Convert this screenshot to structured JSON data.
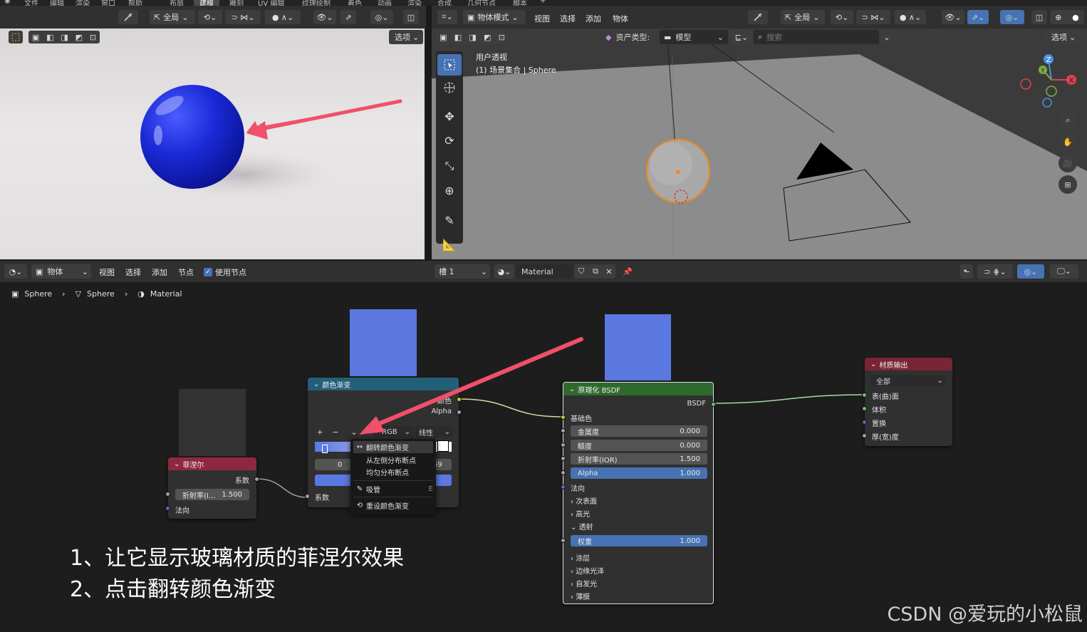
{
  "top_menu": {
    "items": [
      "文件",
      "编辑",
      "渲染",
      "窗口",
      "帮助",
      "布局",
      "建模",
      "雕刻",
      "UV 编辑",
      "纹理绘制",
      "着色",
      "动画",
      "渲染",
      "合成",
      "几何节点",
      "脚本"
    ],
    "active": "建模"
  },
  "render_view": {
    "global_label": "全局",
    "options_label": "选项"
  },
  "viewport": {
    "mode_label": "物体模式",
    "menu": [
      "视图",
      "选择",
      "添加",
      "物体"
    ],
    "global_label": "全局",
    "asset_type_label": "资产类型:",
    "asset_type_value": "模型",
    "search_placeholder": "搜索",
    "options_label": "选项",
    "view_name": "用户透视",
    "collection_path": "(1) 场景集合 | Sphere",
    "gizmo_axes": [
      "Z",
      "Y",
      "X"
    ]
  },
  "node_header": {
    "editor_type_label": "物体",
    "menu": [
      "视图",
      "选择",
      "添加",
      "节点"
    ],
    "use_nodes_label": "使用节点",
    "use_nodes_checked": true,
    "slot_label": "槽 1",
    "material_name": "Material"
  },
  "breadcrumb": {
    "items": [
      "Sphere",
      "Sphere",
      "Material"
    ]
  },
  "nodes": {
    "fresnel": {
      "title": "菲涅尔",
      "output_factor": "系数",
      "ior_label": "折射率(I...",
      "ior_value": "1.500",
      "normal_label": "法向",
      "color": "#8e2840"
    },
    "color_ramp": {
      "title": "颜色渐变",
      "output_color": "颜色",
      "output_alpha": "Alpha",
      "color_mode": "RGB",
      "interpolation": "线性",
      "stop_index": "0",
      "stop_pos_partial": "59",
      "input_factor": "系数",
      "color": "#245f78"
    },
    "principled": {
      "title": "原理化 BSDF",
      "output_label": "BSDF",
      "base_color_label": "基础色",
      "rows": [
        {
          "label": "金属度",
          "value": "0.000",
          "highlight": false
        },
        {
          "label": "糙度",
          "value": "0.000",
          "highlight": false
        },
        {
          "label": "折射率(IOR)",
          "value": "1.500",
          "highlight": false
        },
        {
          "label": "Alpha",
          "value": "1.000",
          "highlight": true
        }
      ],
      "normal_label": "法向",
      "sections_a": [
        "次表面",
        "高光"
      ],
      "transmission_label": "透射",
      "weight_label": "权重",
      "weight_value": "1.000",
      "sections_b": [
        "涂层",
        "边缘光泽",
        "自发光",
        "薄膜"
      ],
      "color": "#2e6a2e"
    },
    "material_output": {
      "title": "材质输出",
      "target": "全部",
      "inputs": [
        "表(曲)面",
        "体积",
        "置换",
        "厚(宽)度"
      ],
      "color": "#7a2436"
    }
  },
  "ramp_menu": {
    "items": [
      {
        "label": "翻转颜色渐变",
        "shortcut": "",
        "highlight": true
      },
      {
        "label": "从左侧分布断点",
        "shortcut": "",
        "highlight": false
      },
      {
        "label": "均匀分布断点",
        "shortcut": "",
        "highlight": false
      },
      {
        "label": "吸管",
        "shortcut": "E",
        "highlight": false
      },
      {
        "label": "重设颜色渐变",
        "shortcut": "",
        "highlight": false
      }
    ]
  },
  "annotations": {
    "line1": "1、让它显示玻璃材质的菲涅尔效果",
    "line2": "2、点击翻转颜色渐变"
  },
  "watermark": "CSDN @爱玩的小松鼠",
  "colors": {
    "preview_blue": "#5a78e0",
    "arrow_red": "#f0506a",
    "active_blue": "#4772b3",
    "socket_yellow": "#c7c729",
    "socket_gray": "#a1a1a1",
    "socket_blue": "#6363c7",
    "socket_green": "#63c763"
  }
}
